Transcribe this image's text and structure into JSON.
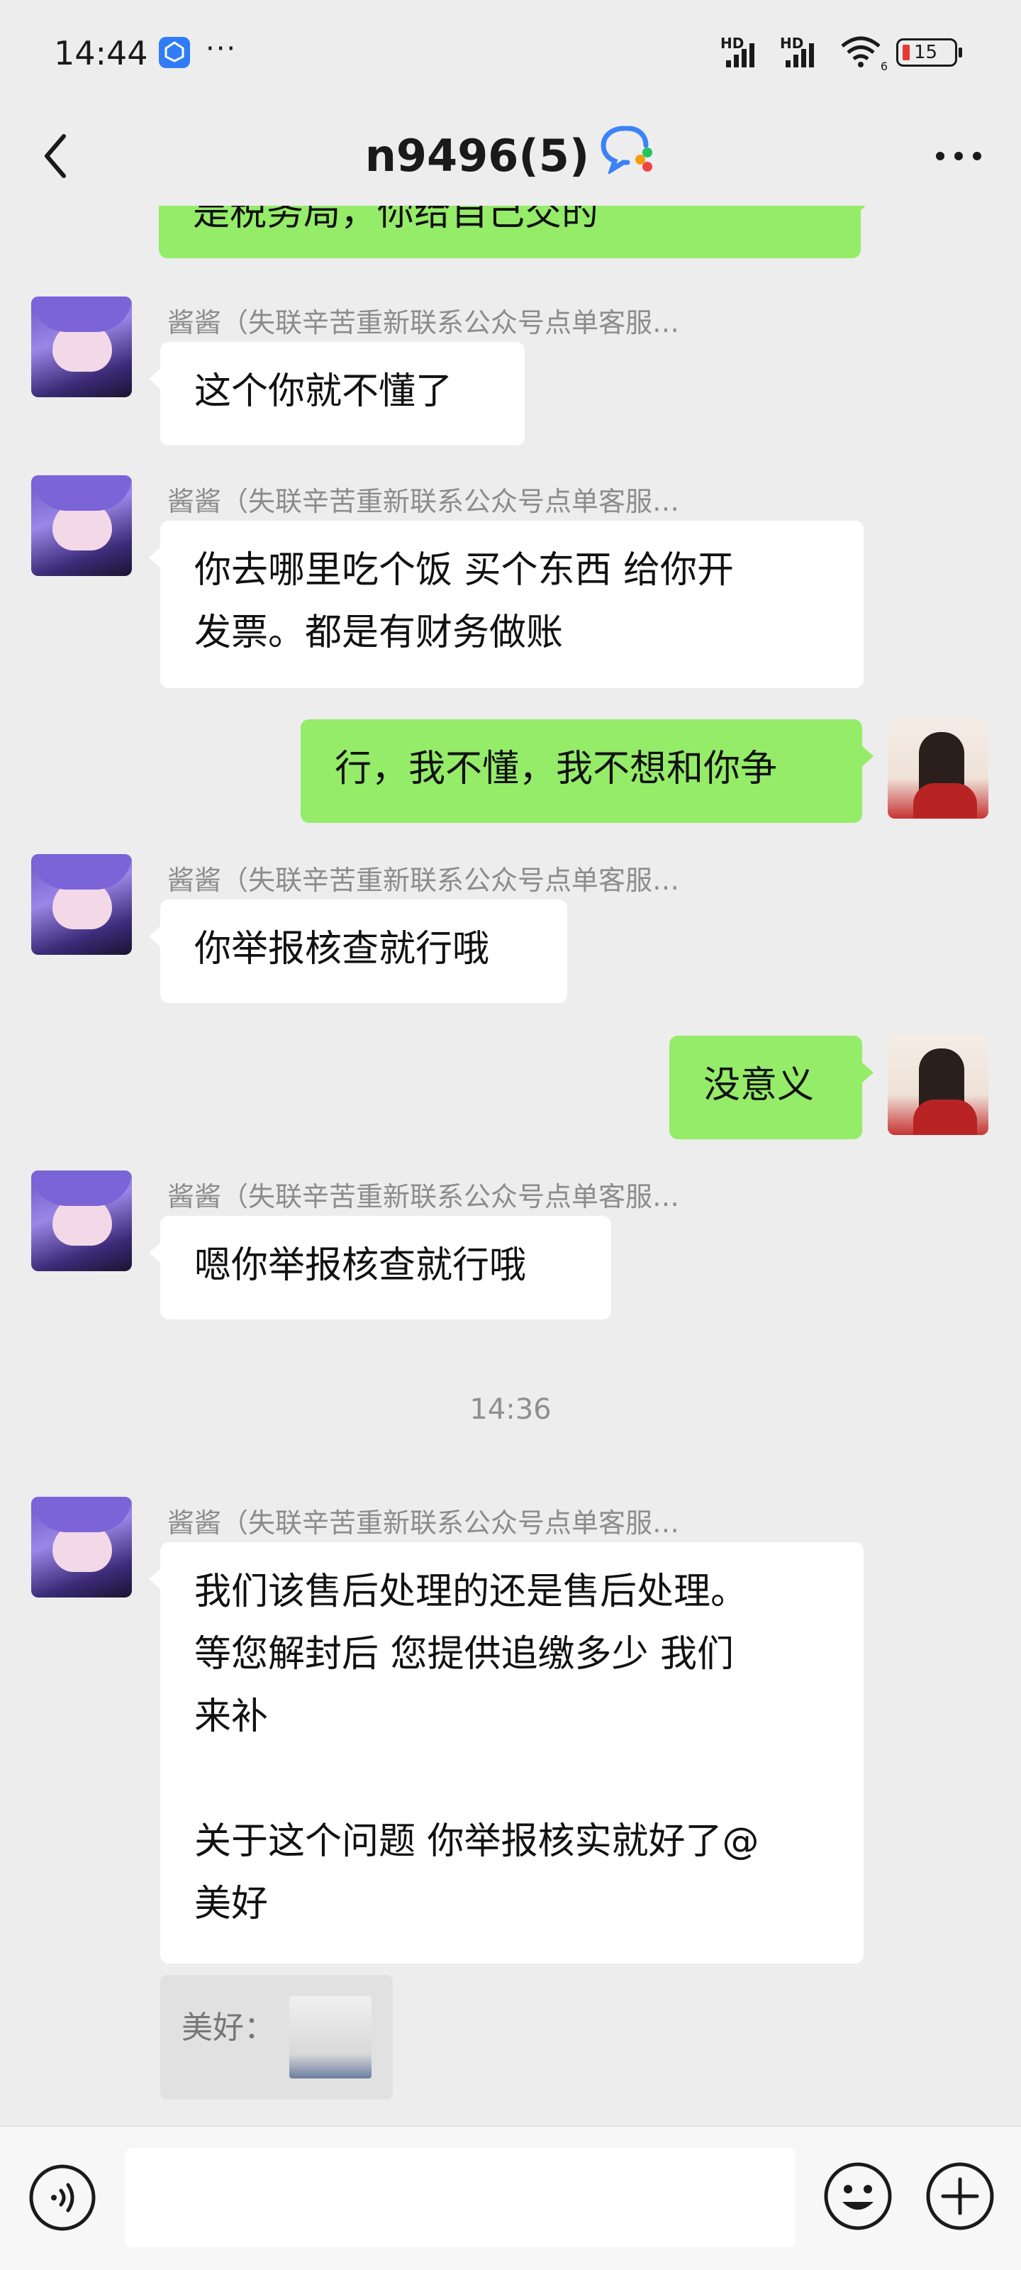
{
  "status_bar": {
    "time": "14:44",
    "app_icon": "ai-app-icon",
    "more_indicator": "···",
    "hd_label_1": "HD",
    "hd_label_2": "HD",
    "wifi_badge": "6",
    "battery": "15"
  },
  "nav": {
    "title": "n9496(5)",
    "back_icon": "chevron-left-icon",
    "chat_icon": "group-chat-icon",
    "more_icon": "more-icon"
  },
  "messages": {
    "m0": {
      "line1": "是税务局，你给自己交的"
    },
    "m1": {
      "sender": "酱酱（失联辛苦重新联系公众号点单客服…",
      "line1": "这个你就不懂了"
    },
    "m2": {
      "sender": "酱酱（失联辛苦重新联系公众号点单客服…",
      "line1": "你去哪里吃个饭 买个东西 给你开",
      "line2": "发票。都是有财务做账"
    },
    "m3": {
      "line1": "行，我不懂，我不想和你争"
    },
    "m4": {
      "sender": "酱酱（失联辛苦重新联系公众号点单客服…",
      "line1": "你举报核查就行哦"
    },
    "m5": {
      "line1": "没意义"
    },
    "m6": {
      "sender": "酱酱（失联辛苦重新联系公众号点单客服…",
      "line1": "嗯你举报核查就行哦"
    },
    "time_divider": "14:36",
    "m7": {
      "sender": "酱酱（失联辛苦重新联系公众号点单客服…",
      "line1": "我们该售后处理的还是售后处理。",
      "line2": "等您解封后 您提供追缴多少 我们",
      "line3": "来补",
      "line4": "关于这个问题 你举报核实就好了@",
      "line5": "美好"
    },
    "quote": {
      "label": "美好："
    }
  },
  "input_bar": {
    "voice_icon": "voice-icon",
    "emoji_icon": "emoji-icon",
    "plus_icon": "plus-icon"
  },
  "colors": {
    "background": "#ededed",
    "incoming_bubble": "#ffffff",
    "outgoing_bubble": "#95ec69",
    "sender_text": "#8c8c8c"
  }
}
